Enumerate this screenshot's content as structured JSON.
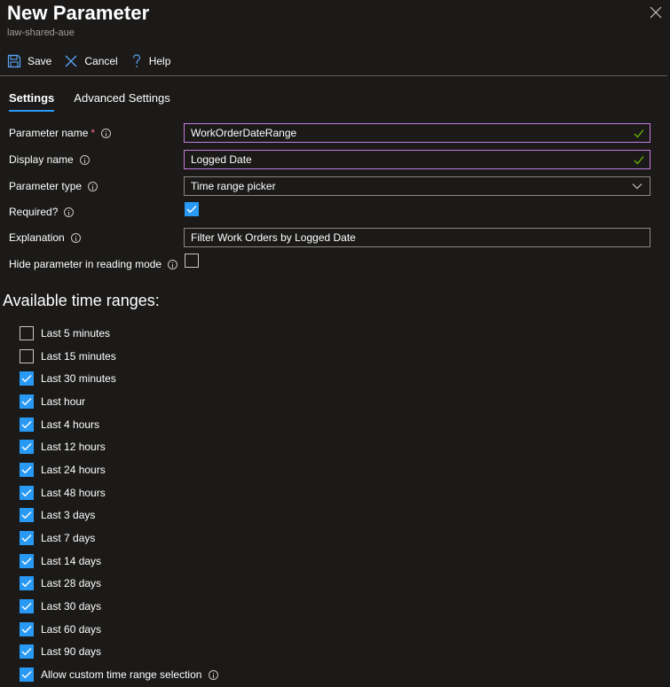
{
  "header": {
    "title": "New Parameter",
    "subtitle": "law-shared-aue"
  },
  "toolbar": {
    "save_label": "Save",
    "cancel_label": "Cancel",
    "help_label": "Help"
  },
  "tabs": [
    {
      "label": "Settings",
      "active": true
    },
    {
      "label": "Advanced Settings",
      "active": false
    }
  ],
  "form": {
    "parameter_name": {
      "label": "Parameter name",
      "required_mark": "*",
      "value": "WorkOrderDateRange",
      "valid": true
    },
    "display_name": {
      "label": "Display name",
      "value": "Logged Date",
      "valid": true
    },
    "parameter_type": {
      "label": "Parameter type",
      "value": "Time range picker"
    },
    "required": {
      "label": "Required?",
      "checked": true
    },
    "explanation": {
      "label": "Explanation",
      "value": "Filter Work Orders by Logged Date"
    },
    "hide_in_reading": {
      "label": "Hide parameter in reading mode",
      "checked": false
    }
  },
  "time_ranges": {
    "heading": "Available time ranges:",
    "items": [
      {
        "label": "Last 5 minutes",
        "checked": false
      },
      {
        "label": "Last 15 minutes",
        "checked": false
      },
      {
        "label": "Last 30 minutes",
        "checked": true
      },
      {
        "label": "Last hour",
        "checked": true
      },
      {
        "label": "Last 4 hours",
        "checked": true
      },
      {
        "label": "Last 12 hours",
        "checked": true
      },
      {
        "label": "Last 24 hours",
        "checked": true
      },
      {
        "label": "Last 48 hours",
        "checked": true
      },
      {
        "label": "Last 3 days",
        "checked": true
      },
      {
        "label": "Last 7 days",
        "checked": true
      },
      {
        "label": "Last 14 days",
        "checked": true
      },
      {
        "label": "Last 28 days",
        "checked": true
      },
      {
        "label": "Last 30 days",
        "checked": true
      },
      {
        "label": "Last 60 days",
        "checked": true
      },
      {
        "label": "Last 90 days",
        "checked": true
      },
      {
        "label": "Allow custom time range selection",
        "checked": true,
        "has_info": true
      }
    ]
  },
  "icons": {
    "save": "save-icon",
    "cancel": "cancel-icon",
    "help": "help-icon",
    "close": "close-icon",
    "info": "info-icon",
    "check": "checkmark-icon",
    "chevron": "chevron-down-icon"
  },
  "colors": {
    "background": "#1b1a19",
    "accent": "#2899f5",
    "focus_border": "#c67ce2",
    "valid_check": "#6bb700",
    "required_star": "#f1707b",
    "muted_text": "#a19f9d"
  }
}
